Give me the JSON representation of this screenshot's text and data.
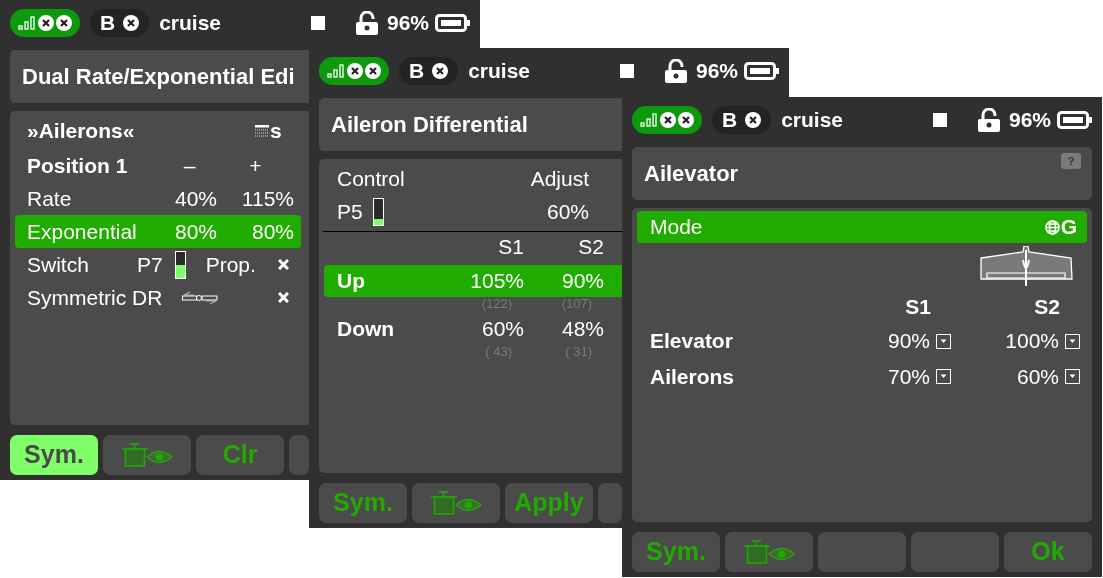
{
  "windows": [
    {
      "kind": "dual_rate",
      "status_bar": {
        "flight_mode": "B",
        "model": "cruise",
        "battery": "96%"
      },
      "title": "Dual Rate/Exponential Edi",
      "panel": {
        "heading": "»Ailerons«",
        "heading_flag": "s",
        "rows": [
          {
            "kind": "header",
            "label": "Position 1",
            "values": [
              "–",
              "+"
            ],
            "selected": false
          },
          {
            "kind": "values",
            "label": "Rate",
            "values": [
              "40%",
              "115%"
            ],
            "selected": false
          },
          {
            "kind": "values",
            "label": "Exponential",
            "values": [
              "80%",
              "80%"
            ],
            "selected": true
          },
          {
            "kind": "switch",
            "label": "Switch",
            "control": "P7",
            "level": 0.5,
            "mode": "Prop.",
            "selected": false
          },
          {
            "kind": "symmetric",
            "label": "Symmetric DR",
            "selected": false
          }
        ]
      },
      "buttons": [
        {
          "kind": "text",
          "label": "Sym.",
          "active": true
        },
        {
          "kind": "icon",
          "active": false
        },
        {
          "kind": "text",
          "label": "Clr",
          "active": false
        },
        {
          "kind": "blank",
          "active": false
        }
      ]
    },
    {
      "kind": "differential",
      "status_bar": {
        "flight_mode": "B",
        "model": "cruise",
        "battery": "96%"
      },
      "title": "Aileron Differential",
      "panel": {
        "control_label": "Control",
        "adjust_label": "Adjust",
        "control": "P5",
        "level": 0.25,
        "adjust": "60%",
        "columns": [
          "S1",
          "S2"
        ],
        "rows": [
          {
            "label": "Up",
            "values": [
              {
                "value": "105%",
                "raw": "(122)"
              },
              {
                "value": "90%",
                "raw": "(107)"
              }
            ],
            "selected": true
          },
          {
            "label": "Down",
            "values": [
              {
                "value": "60%",
                "raw": "( 43)"
              },
              {
                "value": "48%",
                "raw": "( 31)"
              }
            ],
            "selected": false
          }
        ]
      },
      "buttons": [
        {
          "kind": "text",
          "label": "Sym.",
          "active": false
        },
        {
          "kind": "icon",
          "active": false
        },
        {
          "kind": "text",
          "label": "Apply",
          "active": false
        },
        {
          "kind": "blank",
          "active": false
        }
      ]
    },
    {
      "kind": "ailevator",
      "status_bar": {
        "flight_mode": "B",
        "model": "cruise",
        "battery": "96%"
      },
      "title": "Ailevator",
      "help": "?",
      "panel": {
        "mode": {
          "label": "Mode",
          "value": "G",
          "selected": true
        },
        "columns": [
          "S1",
          "S2"
        ],
        "rows": [
          {
            "label": "Elevator",
            "values": [
              "90%",
              "100%"
            ]
          },
          {
            "label": "Ailerons",
            "values": [
              "70%",
              "60%"
            ]
          }
        ]
      },
      "buttons": [
        {
          "kind": "text",
          "label": "Sym.",
          "active": false
        },
        {
          "kind": "icon",
          "active": false
        },
        {
          "kind": "blank",
          "active": false
        },
        {
          "kind": "blank",
          "active": false
        },
        {
          "kind": "text",
          "label": "Ok",
          "active": false
        }
      ]
    }
  ]
}
